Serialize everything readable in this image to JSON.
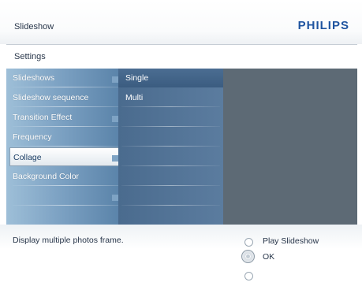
{
  "header": {
    "title": "Slideshow",
    "brand": "PHILIPS"
  },
  "section": {
    "title": "Settings"
  },
  "menu": {
    "items": [
      {
        "label": "Slideshows"
      },
      {
        "label": "Slideshow sequence"
      },
      {
        "label": "Transition Effect"
      },
      {
        "label": "Frequency"
      },
      {
        "label": "Collage",
        "selected": true
      },
      {
        "label": "Background Color"
      },
      {
        "label": ""
      },
      {
        "label": ""
      }
    ]
  },
  "options": {
    "items": [
      {
        "label": "Single",
        "selected": true
      },
      {
        "label": "Multi"
      },
      {
        "label": ""
      },
      {
        "label": ""
      },
      {
        "label": ""
      },
      {
        "label": ""
      },
      {
        "label": ""
      },
      {
        "label": ""
      }
    ]
  },
  "footer": {
    "help_text": "Display multiple photos frame.",
    "play_label": "Play Slideshow",
    "ok_label": "OK"
  },
  "colors": {
    "brand": "#1f54a0",
    "text": "#28364a",
    "left_panel": "#7ea3c4",
    "mid_panel": "#4a6b8e",
    "right_panel": "#5d6a75"
  }
}
